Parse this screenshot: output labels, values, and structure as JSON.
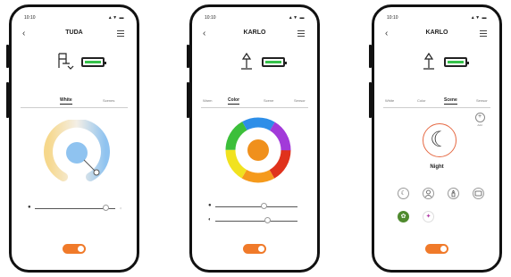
{
  "phones": [
    {
      "status": {
        "time": "10:10",
        "sys": "▲▼ ▬"
      },
      "title": "TUDA",
      "tabs": [
        "White",
        "Scenes"
      ],
      "slider_level": 0.92
    },
    {
      "status": {
        "time": "10:10",
        "sys": "▲▼ ▬"
      },
      "title": "KARLO",
      "tabs": [
        "Warm",
        "Color",
        "Scene",
        "Sensor"
      ],
      "sliders": [
        0.6,
        0.65
      ]
    },
    {
      "status": {
        "time": "10:10",
        "sys": "▲▼ ▬"
      },
      "title": "KARLO",
      "tabs": [
        "White",
        "Color",
        "Scene",
        "Sensor"
      ],
      "add_label": "Add",
      "scene_name": "Night"
    }
  ],
  "colors": {
    "accent": "#f07a2a",
    "battery": "#35c24a",
    "warm_white_blue": "#8fc3f0",
    "color_wheel_center": "#f0901c"
  },
  "icons": {
    "back": "‹",
    "light_bulb": "bulb-icon",
    "moon": "☾",
    "person": "person-icon",
    "candle": "candle-icon",
    "tv": "tv-icon"
  }
}
